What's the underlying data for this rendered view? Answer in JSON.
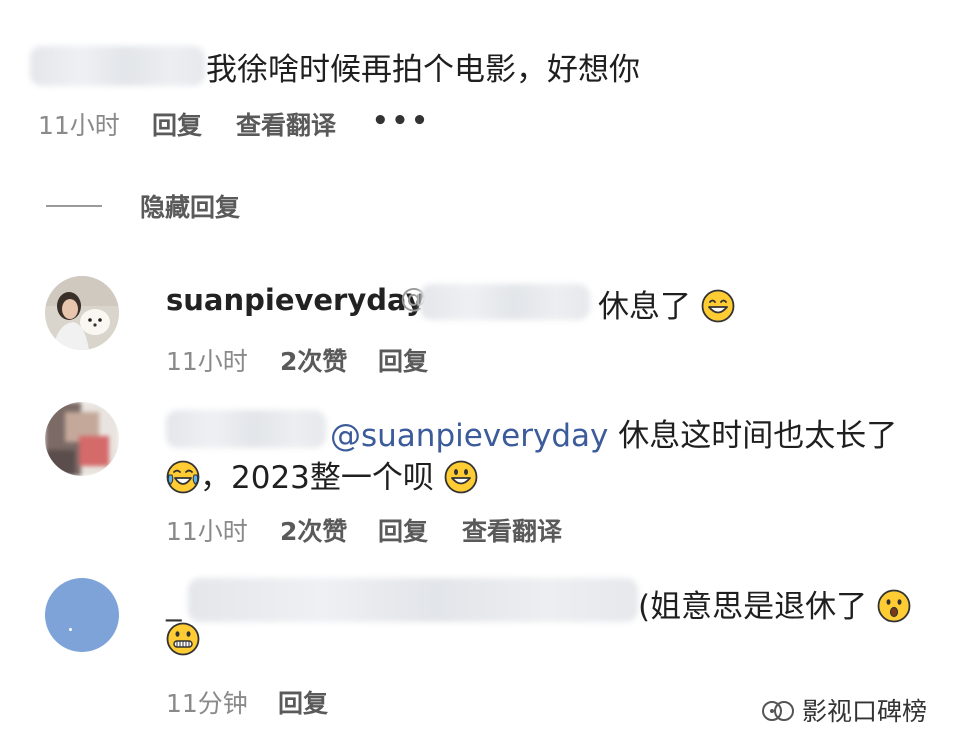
{
  "comment1": {
    "text": "我徐啥时候再拍个电影，好想你",
    "time": "11小时",
    "reply": "回复",
    "translate": "查看翻译",
    "more": "•••"
  },
  "hide_replies": "隐藏回复",
  "reply1": {
    "username": "suanpieveryday",
    "at": "@",
    "text": "休息了",
    "emoji": "grinning-face-with-smiling-eyes",
    "time": "11小时",
    "likes": "2次赞",
    "reply": "回复"
  },
  "reply2": {
    "mention": "@suanpieveryday",
    "text_line1": "休息这时间也太长了",
    "text_line2": "，2023整一个呗",
    "emoji1": "face-with-tears-of-joy",
    "emoji2": "grinning-face",
    "time": "11小时",
    "likes": "2次赞",
    "reply": "回复",
    "translate": "查看翻译"
  },
  "reply3": {
    "prefix": "_",
    "text": "(姐意思是退休了",
    "emoji1": "hushed-face",
    "emoji2": "zipper-mouth-face",
    "time": "11分钟",
    "reply": "回复"
  },
  "watermark": {
    "icon": "wechat-official-account-icon",
    "text": "影视口碑榜"
  },
  "colors": {
    "mention": "#3b5b9a",
    "meta": "#8a8a8a",
    "avatar3": "#7ea3d8"
  }
}
